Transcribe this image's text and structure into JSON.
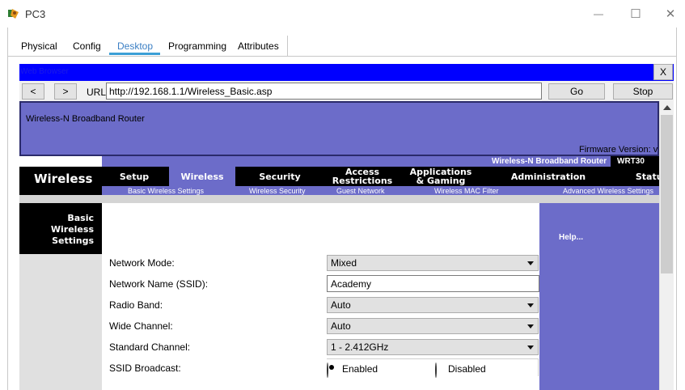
{
  "window": {
    "title": "PC3"
  },
  "controls": {
    "minimize": "—",
    "maximize": "☐",
    "close": "✕"
  },
  "tabs": [
    {
      "label": "Physical",
      "active": false
    },
    {
      "label": "Config",
      "active": false
    },
    {
      "label": "Desktop",
      "active": true
    },
    {
      "label": "Programming",
      "active": false
    },
    {
      "label": "Attributes",
      "active": false
    }
  ],
  "browser": {
    "title": "Web Browser",
    "close_label": "X",
    "back_label": "<",
    "forward_label": ">",
    "url_label": "URL",
    "url_value": "http://192.168.1.1/Wireless_Basic.asp",
    "go_label": "Go",
    "stop_label": "Stop"
  },
  "router": {
    "brand": "Wireless-N Broadband Router",
    "firmware": "Firmware Version: v",
    "model_line": "Wireless-N Broadband Router",
    "model": "WRT30",
    "section": "Wireless",
    "nav": [
      {
        "label": "Setup",
        "active": false
      },
      {
        "label": "Wireless",
        "active": true
      },
      {
        "label": "Security",
        "active": false
      },
      {
        "label": "Access Restrictions",
        "active": false
      },
      {
        "label": "Applications & Gaming",
        "active": false
      },
      {
        "label": "Administration",
        "active": false
      },
      {
        "label": "Status",
        "active": false
      }
    ],
    "subnav": [
      "Basic Wireless Settings",
      "Wireless Security",
      "Guest Network",
      "Wireless MAC Filter",
      "Advanced Wireless Settings"
    ],
    "page_heading": "Basic Wireless Settings",
    "help": "Help...",
    "form": {
      "network_mode": {
        "label": "Network Mode:",
        "value": "Mixed"
      },
      "ssid": {
        "label": "Network Name (SSID):",
        "value": "Academy"
      },
      "radio_band": {
        "label": "Radio Band:",
        "value": "Auto"
      },
      "wide_channel": {
        "label": "Wide Channel:",
        "value": "Auto"
      },
      "standard_channel": {
        "label": "Standard Channel:",
        "value": "1 - 2.412GHz"
      },
      "ssid_broadcast": {
        "label": "SSID Broadcast:",
        "enabled_label": "Enabled",
        "disabled_label": "Disabled",
        "selected": "Enabled"
      }
    }
  },
  "colors": {
    "accent": "#0000ff",
    "router_purple": "#6c6cc9",
    "tab_underline": "#3b9fd6",
    "black": "#000000"
  }
}
